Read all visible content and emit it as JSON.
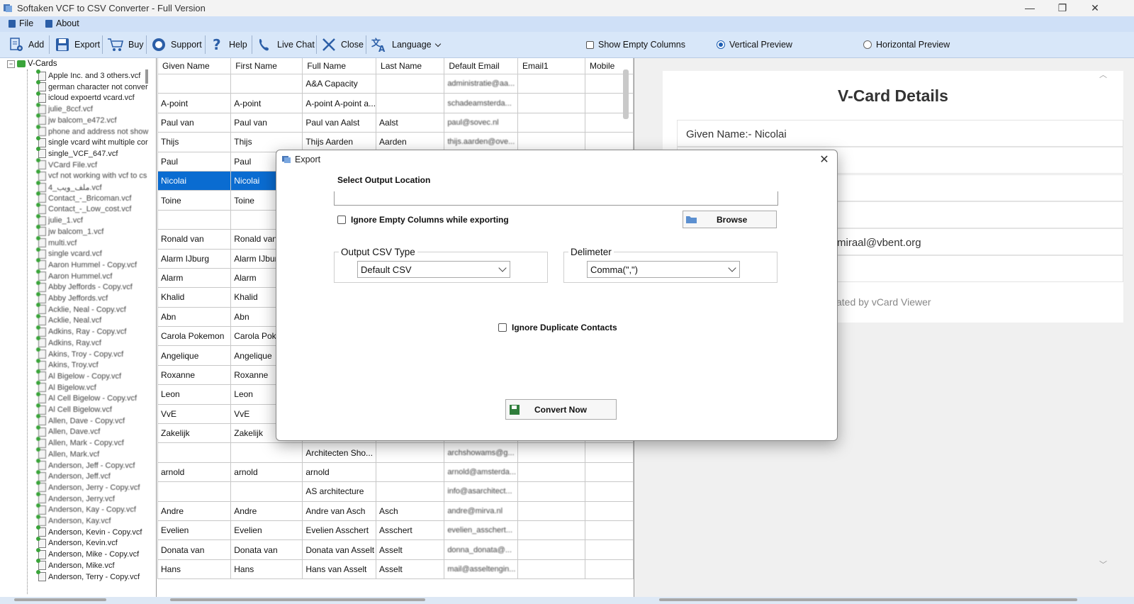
{
  "window": {
    "title": "Softaken VCF to CSV Converter - Full Version"
  },
  "menu": [
    {
      "label": "File",
      "icon": "file-menu-icon"
    },
    {
      "label": "About",
      "icon": "about-menu-icon"
    }
  ],
  "toolbar": {
    "add": "Add",
    "export": "Export",
    "buy": "Buy",
    "support": "Support",
    "help": "Help",
    "live_chat": "Live Chat",
    "close": "Close",
    "language": "Language",
    "show_empty_columns": "Show Empty Columns",
    "vertical_preview": "Vertical Preview",
    "horizontal_preview": "Horizontal Preview"
  },
  "tree": {
    "root": "V-Cards",
    "items": [
      "Apple Inc. and 3 others.vcf",
      "german character not conver",
      "icloud expoertd vcard.vcf",
      "julie_8ccf.vcf",
      "jw balcom_e472.vcf",
      "phone and address not show",
      "single vcard wiht multiple cor",
      "single_VCF_647.vcf",
      "VCard File.vcf",
      "vcf not working with vcf to cs",
      "4_ملف_ويب.vcf",
      "Contact_-_Bricoman.vcf",
      "Contact_-_Low_cost.vcf",
      "julie_1.vcf",
      "jw balcom_1.vcf",
      "multi.vcf",
      "single vcard.vcf",
      "Aaron Hummel - Copy.vcf",
      "Aaron Hummel.vcf",
      "Abby Jeffords - Copy.vcf",
      "Abby Jeffords.vcf",
      "Acklie, Neal - Copy.vcf",
      "Acklie, Neal.vcf",
      "Adkins, Ray - Copy.vcf",
      "Adkins, Ray.vcf",
      "Akins, Troy - Copy.vcf",
      "Akins, Troy.vcf",
      "Al Bigelow - Copy.vcf",
      "Al Bigelow.vcf",
      "Al Cell Bigelow - Copy.vcf",
      "Al Cell Bigelow.vcf",
      "Allen, Dave - Copy.vcf",
      "Allen, Dave.vcf",
      "Allen, Mark - Copy.vcf",
      "Allen, Mark.vcf",
      "Anderson, Jeff - Copy.vcf",
      "Anderson, Jeff.vcf",
      "Anderson, Jerry - Copy.vcf",
      "Anderson, Jerry.vcf",
      "Anderson, Kay - Copy.vcf",
      "Anderson, Kay.vcf",
      "Anderson, Kevin - Copy.vcf",
      "Anderson, Kevin.vcf",
      "Anderson, Mike - Copy.vcf",
      "Anderson, Mike.vcf",
      "Anderson, Terry - Copy.vcf"
    ]
  },
  "grid": {
    "columns": [
      "Given Name",
      "First Name",
      "Full Name",
      "Last Name",
      "Default Email",
      "Email1",
      "Mobile"
    ],
    "rows": [
      [
        "",
        "",
        "A&A Capacity",
        "",
        "administratie@aa...",
        "",
        ""
      ],
      [
        "A-point",
        "A-point",
        "A-point A-point a...",
        "",
        "schadeamsterda...",
        "",
        ""
      ],
      [
        "Paul van",
        "Paul van",
        "Paul van Aalst",
        "Aalst",
        "paul@sovec.nl",
        "",
        ""
      ],
      [
        "Thijs",
        "Thijs",
        "Thijs Aarden",
        "Aarden",
        "thijs.aarden@ove...",
        "",
        ""
      ],
      [
        "Paul",
        "Paul",
        "",
        "",
        "",
        "",
        ""
      ],
      [
        "Nicolai",
        "Nicolai",
        "",
        "",
        "",
        "",
        ""
      ],
      [
        "Toine",
        "Toine",
        "",
        "",
        "",
        "",
        ""
      ],
      [
        "",
        "",
        "",
        "",
        "",
        "",
        ""
      ],
      [
        "Ronald van",
        "Ronald van",
        "",
        "",
        "",
        "",
        ""
      ],
      [
        "Alarm IJburg",
        "Alarm IJburg",
        "",
        "",
        "",
        "",
        ""
      ],
      [
        "Alarm",
        "Alarm",
        "",
        "",
        "",
        "",
        ""
      ],
      [
        "Khalid",
        "Khalid",
        "",
        "",
        "",
        "",
        ""
      ],
      [
        "Abn",
        "Abn",
        "",
        "",
        "",
        "",
        ""
      ],
      [
        "Carola Pokemon",
        "Carola Pokem",
        "",
        "",
        "",
        "",
        ""
      ],
      [
        "Angelique",
        "Angelique",
        "",
        "",
        "",
        "",
        ""
      ],
      [
        "Roxanne",
        "Roxanne",
        "",
        "",
        "",
        "",
        ""
      ],
      [
        "Leon",
        "Leon",
        "",
        "",
        "",
        "",
        ""
      ],
      [
        "VvE",
        "VvE",
        "",
        "",
        "",
        "",
        ""
      ],
      [
        "Zakelijk",
        "Zakelijk",
        "",
        "",
        "",
        "",
        ""
      ],
      [
        "",
        "",
        "Architecten Sho...",
        "",
        "archshowams@g...",
        "",
        ""
      ],
      [
        "arnold",
        "arnold",
        "arnold",
        "",
        "arnold@amsterda...",
        "",
        ""
      ],
      [
        "",
        "",
        "AS architecture",
        "",
        "info@asarchitect...",
        "",
        ""
      ],
      [
        "Andre",
        "Andre",
        "Andre van Asch",
        "Asch",
        "andre@mirva.nl",
        "",
        ""
      ],
      [
        "Evelien",
        "Evelien",
        "Evelien Asschert",
        "Asschert",
        "evelien_asschert...",
        "",
        ""
      ],
      [
        "Donata van",
        "Donata van",
        "Donata van Asselt",
        "Asselt",
        "donna_donata@...",
        "",
        ""
      ],
      [
        "Hans",
        "Hans",
        "Hans van Asselt",
        "Asselt",
        "mail@asseltengin...",
        "",
        ""
      ]
    ],
    "selected_row": 5
  },
  "detail": {
    "title": "V-Card Details",
    "given_name": "Given Name:- Nicolai",
    "email_fragment": "miraal@vbent.org",
    "footer_fragment": "ated by vCard Viewer"
  },
  "export_dialog": {
    "title": "Export",
    "select_output_location": "Select Output Location",
    "output_path": "",
    "ignore_empty_columns": "Ignore Empty Columns while exporting",
    "browse": "Browse",
    "output_csv_type_label": "Output CSV Type",
    "output_csv_type_value": "Default CSV",
    "delimeter_label": "Delimeter",
    "delimeter_value": "Comma(\",\")",
    "ignore_duplicates": "Ignore Duplicate Contacts",
    "convert_now": "Convert Now"
  },
  "colors": {
    "accent": "#0a6cd1",
    "toolbar_bg": "#d8e7f9",
    "menubar_bg": "#cfe0f7"
  }
}
